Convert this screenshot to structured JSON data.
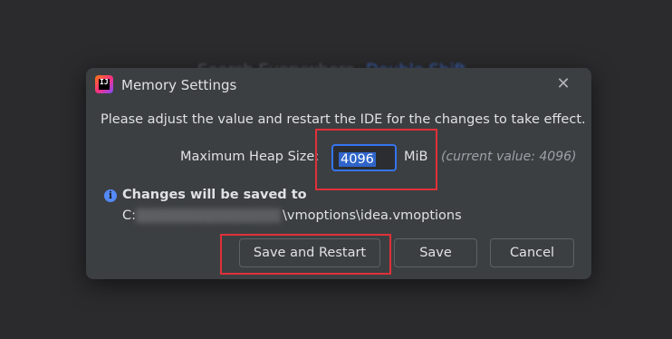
{
  "background": {
    "hint_text": "Search Everywhere",
    "hint_shortcut": "Double Shift"
  },
  "dialog": {
    "title": "Memory Settings",
    "close_icon": "close-icon",
    "app_icon": "intellij-idea-icon",
    "instruction": "Please adjust the value and restart the IDE for the changes to take effect.",
    "heap": {
      "label": "Maximum Heap Size:",
      "value": "4096",
      "unit": "MiB",
      "current_value": "(current value: 4096)"
    },
    "saved": {
      "info_icon": "info-icon",
      "title": "Changes will be saved to",
      "path_prefix": "C:",
      "path_suffix": "\\vmoptions\\idea.vmoptions"
    },
    "buttons": {
      "save_restart": "Save and Restart",
      "save": "Save",
      "cancel": "Cancel"
    }
  },
  "colors": {
    "dialog_bg": "#3c3f41",
    "accent": "#3574f0",
    "annotation_red": "#e0303a"
  }
}
